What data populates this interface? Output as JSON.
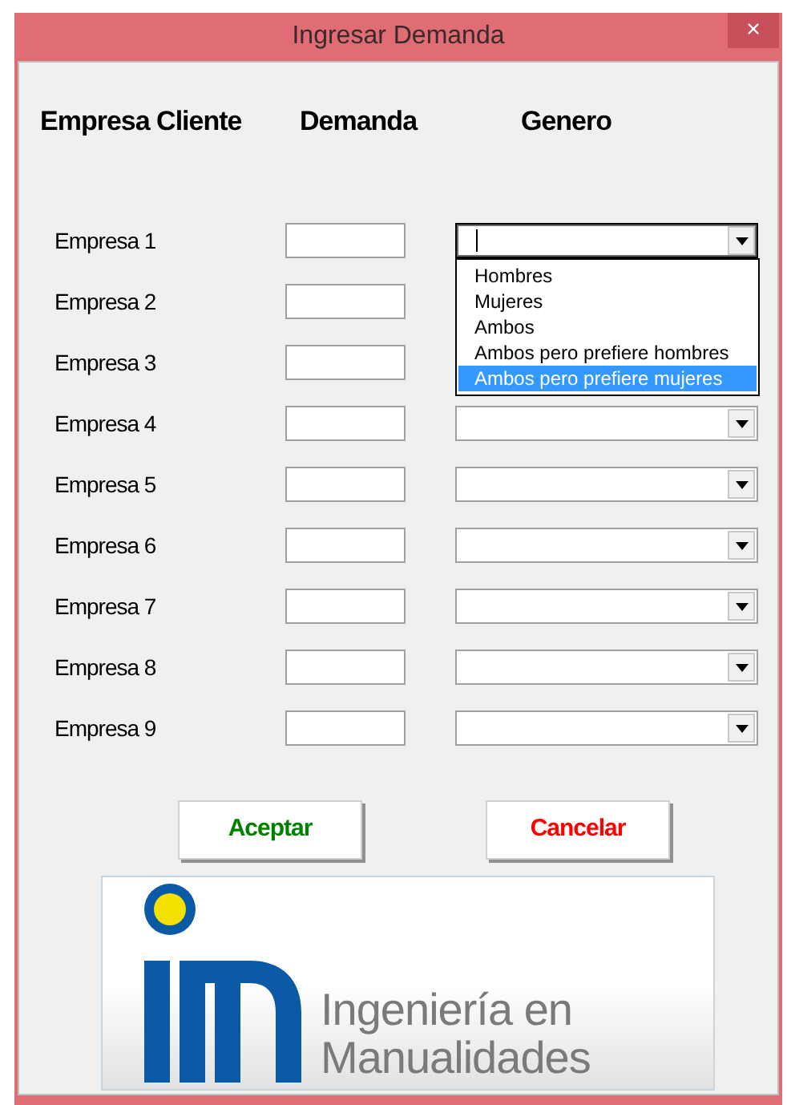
{
  "window": {
    "title": "Ingresar Demanda",
    "close": "×"
  },
  "headers": [
    "Empresa Cliente",
    "Demanda",
    "Genero"
  ],
  "rows": [
    {
      "label": "Empresa 1",
      "demanda": "",
      "genero": {
        "expanded": true
      }
    },
    {
      "label": "Empresa 2",
      "demanda": ""
    },
    {
      "label": "Empresa 3",
      "demanda": ""
    },
    {
      "label": "Empresa 4",
      "demanda": "",
      "genero": {
        "expanded": false
      }
    },
    {
      "label": "Empresa 5",
      "demanda": "",
      "genero": {
        "expanded": false
      }
    },
    {
      "label": "Empresa 6",
      "demanda": "",
      "genero": {
        "expanded": false
      }
    },
    {
      "label": "Empresa 7",
      "demanda": "",
      "genero": {
        "expanded": false
      }
    },
    {
      "label": "Empresa 8",
      "demanda": "",
      "genero": {
        "expanded": false
      }
    },
    {
      "label": "Empresa 9",
      "demanda": "",
      "genero": {
        "expanded": false
      }
    }
  ],
  "dropdown_options": [
    {
      "label": "Hombres",
      "selected": false
    },
    {
      "label": "Mujeres",
      "selected": false
    },
    {
      "label": "Ambos",
      "selected": false
    },
    {
      "label": "Ambos pero prefiere hombres",
      "selected": false
    },
    {
      "label": "Ambos pero prefiere mujeres",
      "selected": true
    }
  ],
  "buttons": [
    {
      "label": "Aceptar",
      "kind": "accept"
    },
    {
      "label": "Cancelar",
      "kind": "cancel"
    }
  ],
  "logo": {
    "line1": "Ingeniería en",
    "line2": "Manualidades"
  }
}
